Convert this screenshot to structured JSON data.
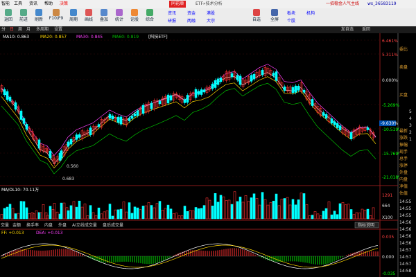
{
  "menu": {
    "items": [
      "智能",
      "工具",
      "资讯",
      "帮助",
      "决策"
    ],
    "center_title": "同花顺",
    "center_sub": "ETF»技术分析",
    "right_promo": "一招稳金人气主线",
    "account": "ws_36583119"
  },
  "toolbar": {
    "buttons": [
      "返回",
      "前进",
      "刷新",
      "F10/F9",
      "周期",
      "画线",
      "叠加",
      "统计",
      "论股",
      "综合"
    ],
    "center_buttons": [
      "资讯",
      "研报",
      "资金",
      "两融",
      "港股",
      "大宗"
    ],
    "right_buttons": [
      "自选",
      "全屏",
      "板块",
      "个股",
      "机构"
    ]
  },
  "tabs": {
    "left": [
      "分",
      "日",
      "周",
      "月",
      "多周期",
      "设置"
    ],
    "right": [
      "加自选",
      "返回"
    ]
  },
  "legend": {
    "ma10": "MA10: 0.863",
    "ma20": "MA20: 0.857",
    "ma30": "MA30: 0.845",
    "ma60": "MA60: 0.819",
    "name": "[科技ETF]"
  },
  "price_axis": [
    "6.461%",
    "5.311%",
    "0.000%",
    "-5.269%",
    "-10.519%",
    "-15.769%",
    "-21.018%"
  ],
  "annotations": {
    "low1": "0.560",
    "low2": "0.683",
    "cur": "-9.630%"
  },
  "vol": {
    "label": "MA/OL10: 70.11万",
    "axis": [
      "1291",
      "664",
      "X100"
    ]
  },
  "ind_tabs": [
    "交量",
    "金额",
    "换手率",
    "内盘",
    "外盘",
    "AI立线成交量",
    "盘后成交量"
  ],
  "macd": {
    "label": "FF: +0.013",
    "dea": "DEA: +0.013",
    "btn": "指标说明",
    "axis": [
      "0.035",
      "0.000",
      "-0.035"
    ]
  },
  "right_panel": [
    "委比",
    "卖盘",
    "买盘",
    "最新",
    "涨跌",
    "振幅",
    "现手",
    "总手",
    "涨停",
    "外盘",
    "内盘",
    "净值",
    "估值"
  ],
  "right_panel_vals": [
    "5",
    "4",
    "3",
    "2",
    "1"
  ],
  "times": [
    "14:55",
    "14:55",
    "14:55",
    "14:56",
    "14:56",
    "14:56",
    "14:56",
    "14:57",
    "14:57",
    "14:57",
    "14:58"
  ],
  "colors": {
    "up": "#ff3232",
    "down": "#00ffff",
    "ma10": "#ffffff",
    "ma20": "#ffd700",
    "ma30": "#ff40ff",
    "ma60": "#00c000"
  }
}
